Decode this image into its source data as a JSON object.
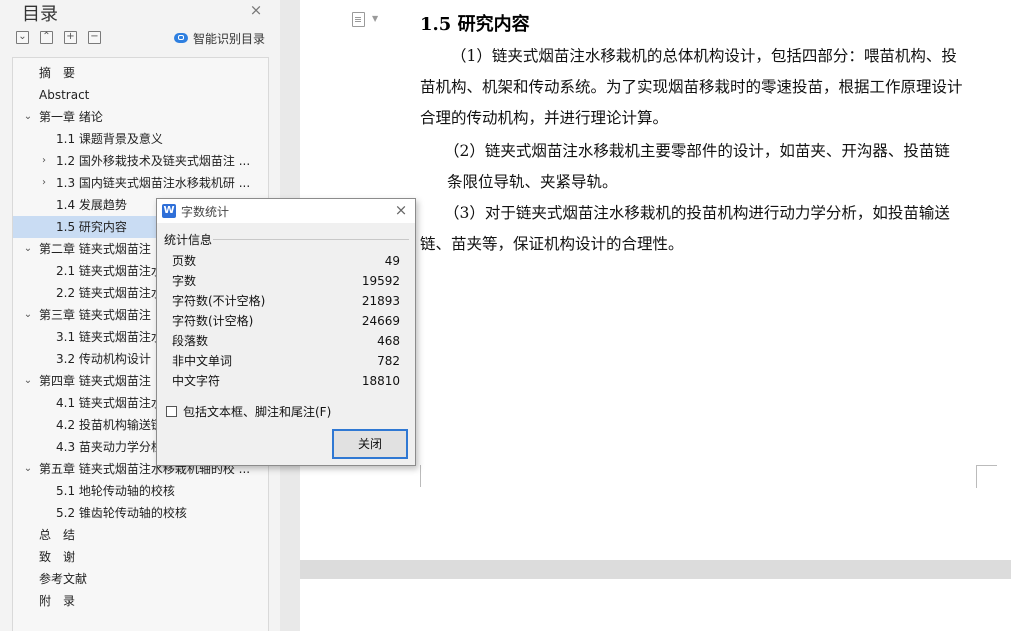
{
  "toc": {
    "title": "目录",
    "close_icon": "×",
    "toolbar": {
      "collapse": "⌄",
      "expand": "⌃",
      "add": "+",
      "remove": "−"
    },
    "smart_toc_label": "智能识别目录",
    "items": [
      {
        "label": "摘　要",
        "level": 1,
        "arrow": ""
      },
      {
        "label": "Abstract",
        "level": 1,
        "arrow": ""
      },
      {
        "label": "第一章  绪论",
        "level": 1,
        "arrow": "⌄"
      },
      {
        "label": "1.1 课题背景及意义",
        "level": 2,
        "arrow": ""
      },
      {
        "label": "1.2 国外移栽技术及链夹式烟苗注 ...",
        "level": 2,
        "arrow": "›"
      },
      {
        "label": "1.3  国内链夹式烟苗注水移栽机研 ...",
        "level": 2,
        "arrow": "›"
      },
      {
        "label": "1.4 发展趋势",
        "level": 2,
        "arrow": ""
      },
      {
        "label": "1.5 研究内容",
        "level": 2,
        "arrow": "",
        "selected": true
      },
      {
        "label": "第二章  链夹式烟苗注",
        "level": 1,
        "arrow": "⌄"
      },
      {
        "label": "2.1 链夹式烟苗注水",
        "level": 2,
        "arrow": ""
      },
      {
        "label": "2.2 链夹式烟苗注水",
        "level": 2,
        "arrow": ""
      },
      {
        "label": "第三章  链夹式烟苗注",
        "level": 1,
        "arrow": "⌄"
      },
      {
        "label": "3.1 链夹式烟苗注水",
        "level": 2,
        "arrow": ""
      },
      {
        "label": "3.2 传动机构设计",
        "level": 2,
        "arrow": ""
      },
      {
        "label": "第四章  链夹式烟苗注",
        "level": 1,
        "arrow": "⌄"
      },
      {
        "label": "4.1 链夹式烟苗注水",
        "level": 2,
        "arrow": ""
      },
      {
        "label": "4.2 投苗机构输送链",
        "level": 2,
        "arrow": ""
      },
      {
        "label": "4.3 苗夹动力学分析",
        "level": 2,
        "arrow": ""
      },
      {
        "label": "第五章  链夹式烟苗注水移栽机轴的校 ...",
        "level": 1,
        "arrow": "⌄"
      },
      {
        "label": "5.1 地轮传动轴的校核",
        "level": 2,
        "arrow": ""
      },
      {
        "label": "5.2 锥齿轮传动轴的校核",
        "level": 2,
        "arrow": ""
      },
      {
        "label": "总　结",
        "level": 1,
        "arrow": ""
      },
      {
        "label": "致　谢",
        "level": 1,
        "arrow": ""
      },
      {
        "label": "参考文献",
        "level": 1,
        "arrow": ""
      },
      {
        "label": "附　录",
        "level": 1,
        "arrow": ""
      }
    ]
  },
  "document": {
    "heading": "1.5 研究内容",
    "paragraphs": [
      "（1）链夹式烟苗注水移栽机的总体机构设计，包括四部分：喂苗机构、投",
      "苗机构、机架和传动系统。为了实现烟苗移栽时的零速投苗，根据工作原理设计",
      "合理的传动机构，并进行理论计算。",
      "（2）链夹式烟苗注水移栽机主要零部件的设计，如苗夹、开沟器、投苗链",
      "条限位导轨、夹紧导轨。",
      "（3）对于链夹式烟苗注水移栽机的投苗机构进行动力学分析，如投苗输送",
      "链、苗夹等，保证机构设计的合理性。"
    ]
  },
  "dialog": {
    "app_icon": "W",
    "title": "字数统计",
    "close_icon": "×",
    "section": "统计信息",
    "stats": [
      {
        "label": "页数",
        "value": "49"
      },
      {
        "label": "字数",
        "value": "19592"
      },
      {
        "label": "字符数(不计空格)",
        "value": "21893"
      },
      {
        "label": "字符数(计空格)",
        "value": "24669"
      },
      {
        "label": "段落数",
        "value": "468"
      },
      {
        "label": "非中文单词",
        "value": "782"
      },
      {
        "label": "中文字符",
        "value": "18810"
      }
    ],
    "checkbox_label": "包括文本框、脚注和尾注(F)",
    "checkbox_checked": false,
    "close_button": "关闭"
  }
}
